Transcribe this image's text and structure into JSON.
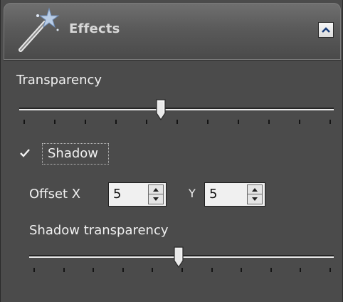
{
  "panel": {
    "title": "Effects",
    "icon": "magic-wand-icon",
    "collapse_icon": "chevron-up-icon"
  },
  "transparency": {
    "label": "Transparency",
    "value_fraction": 0.45,
    "tick_count": 11
  },
  "shadow": {
    "label": "Shadow",
    "checked": true,
    "offset_x_label": "Offset X",
    "offset_x_value": "5",
    "y_label": "Y",
    "y_value": "5",
    "transparency_label": "Shadow transparency",
    "transparency_fraction": 0.49,
    "tick_count": 11
  },
  "colors": {
    "panel_bg": "#4b4b4b",
    "text": "#f0f0f0",
    "input_bg": "#f0f0f0"
  }
}
